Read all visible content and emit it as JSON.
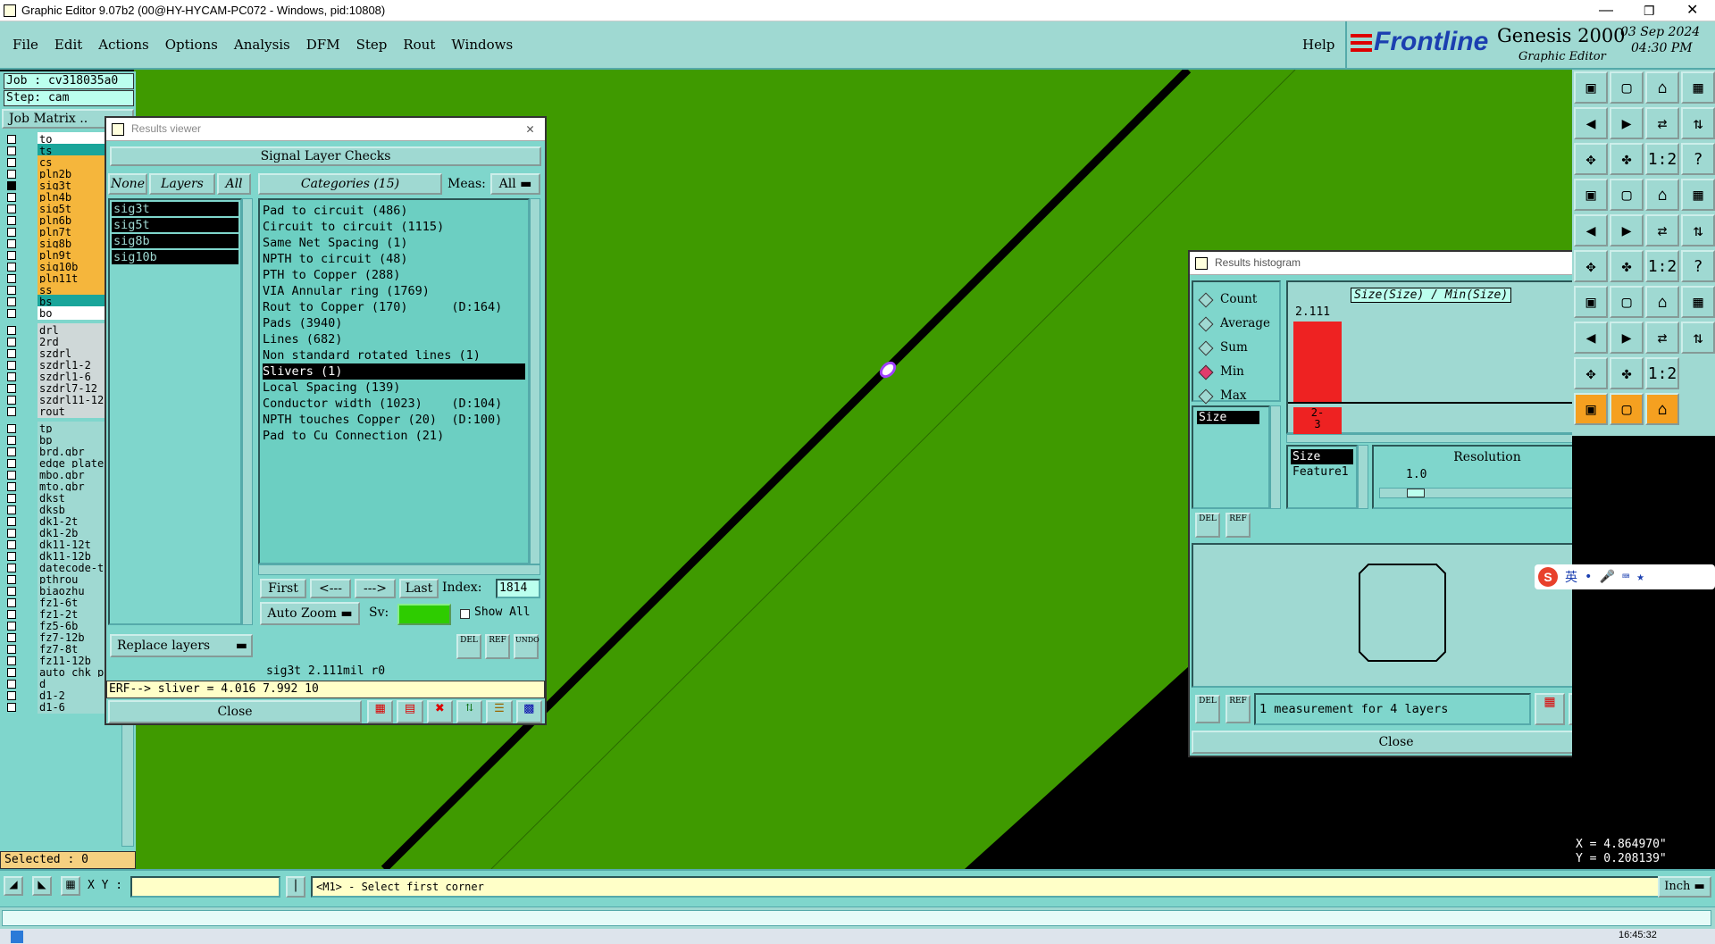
{
  "window": {
    "title": "Graphic Editor 9.07b2 (00@HY-HYCAM-PC072 - Windows, pid:10808)"
  },
  "menu": [
    "File",
    "Edit",
    "Actions",
    "Options",
    "Analysis",
    "DFM",
    "Step",
    "Rout",
    "Windows"
  ],
  "help": "Help",
  "brand": {
    "logo": "Frontline",
    "product": "Genesis 2000",
    "subtitle": "Graphic Editor",
    "date": "03 Sep 2024",
    "time": "04:30 PM"
  },
  "job": {
    "job_label": "Job : cv318035a0",
    "step_label": "Step: cam",
    "matrix_label": "Job Matrix .."
  },
  "layers_group1": [
    "to",
    "ts",
    "cs",
    "pln2b",
    "sig3t",
    "pln4b",
    "sig5t",
    "pln6b",
    "pln7t",
    "sig8b",
    "pln9t",
    "sig10b",
    "pln11t",
    "ss",
    "bs",
    "bo"
  ],
  "layers_group2": [
    "drl",
    "2rd",
    "szdrl",
    "szdrl1-2",
    "szdrl1-6",
    "szdrl7-12",
    "szdrl11-12",
    "rout"
  ],
  "layers_group3": [
    "tp",
    "bp",
    "brd.gbr",
    "edge_plated",
    "mbo.gbr",
    "mto.gbr",
    "dkst",
    "dksb",
    "dk1-2t",
    "dk1-2b",
    "dk11-12t",
    "dk11-12b",
    "datecode-to",
    "pthrou",
    "biaozhu",
    "fz1-6t",
    "fz1-2t",
    "fz5-6b",
    "fz7-12b",
    "fz7-8t",
    "fz11-12b",
    "auto_chk_pn",
    "d",
    "d1-2",
    "d1-6"
  ],
  "selected": "Selected : 0",
  "results_viewer": {
    "title": "Results viewer",
    "header": "Signal Layer Checks",
    "btn_none": "None",
    "btn_layers": "Layers",
    "btn_all": "All",
    "categories_btn": "Categories (15)",
    "meas_label": "Meas:",
    "meas_value": "All",
    "layers": [
      "sig3t",
      "sig5t",
      "sig8b",
      "sig10b"
    ],
    "categories": [
      "Pad to circuit (486)",
      "Circuit to circuit (1115)",
      "Same Net Spacing (1)",
      "NPTH to circuit (48)",
      "PTH to Copper (288)",
      "VIA Annular ring (1769)",
      "Rout to Copper (170)      (D:164)",
      "Pads (3940)",
      "Lines (682)",
      "Non standard rotated lines (1)",
      "Slivers (1)",
      "Local Spacing (139)",
      "Conductor width (1023)    (D:104)",
      "NPTH touches Copper (20)  (D:100)",
      "Pad to Cu Connection (21)"
    ],
    "nav": {
      "first": "First",
      "prev": "<---",
      "next": "--->",
      "last": "Last",
      "index_label": "Index:",
      "index_value": "1814"
    },
    "auto_zoom": "Auto Zoom",
    "sv_label": "Sv:",
    "show_all": "Show All",
    "replace_layers": "Replace layers",
    "del": "DEL",
    "ref": "REF",
    "undo": "UNDO",
    "status": "sig3t 2.111mil  r0",
    "erf": "ERF--> sliver = 4.016 7.992 10",
    "close": "Close"
  },
  "histogram": {
    "title": "Results histogram",
    "options": [
      "Count",
      "Average",
      "Sum",
      "Min",
      "Max"
    ],
    "selected_option": "Min",
    "chart_title": "Size(Size) / Min(Size)",
    "bar_value": "2.111",
    "bar_label": "2-\n3",
    "list": [
      "Size"
    ],
    "list2": [
      "Size",
      "Feature1"
    ],
    "resolution_label": "Resolution",
    "resolution_value": "1.0",
    "measurement": "1 measurement for 4 layers",
    "close": "Close",
    "del": "DEL",
    "ref": "REF"
  },
  "coords": {
    "x": "X = 4.864970\"",
    "y": "Y = 0.208139\""
  },
  "bottom": {
    "xy_label": "X Y :",
    "prompt": "<M1> - Select first corner",
    "unit": "Inch"
  },
  "ime": {
    "label": "英"
  },
  "clock": "16:45:32"
}
